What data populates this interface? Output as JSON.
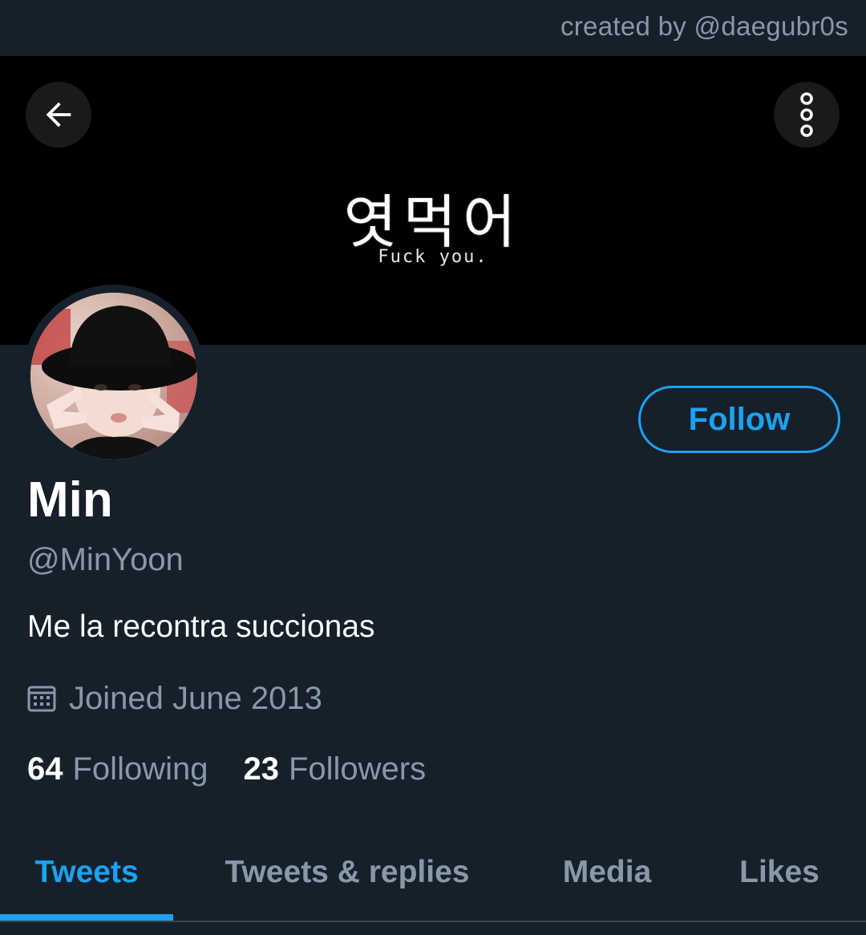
{
  "credit": {
    "text": "created by @daegubr0s"
  },
  "banner": {
    "korean_text": "엿먹어",
    "english_text": "Fuck you."
  },
  "header": {
    "back_icon": "arrow-left-icon",
    "more_icon": "more-vertical-icon"
  },
  "profile": {
    "display_name": "Min",
    "handle": "@MinYoon",
    "bio": "Me la recontra succionas",
    "joined_icon": "calendar-icon",
    "joined": "Joined June 2013",
    "follow_label": "Follow",
    "following_count": "64",
    "following_label": "Following",
    "followers_count": "23",
    "followers_label": "Followers"
  },
  "tabs": [
    {
      "label": "Tweets",
      "active": true
    },
    {
      "label": "Tweets & replies",
      "active": false
    },
    {
      "label": "Media",
      "active": false
    },
    {
      "label": "Likes",
      "active": false
    }
  ],
  "colors": {
    "background": "#15202b",
    "accent": "#1da1f2",
    "secondary_text": "#8899a6",
    "primary_text": "#ffffff",
    "banner": "#000000"
  }
}
